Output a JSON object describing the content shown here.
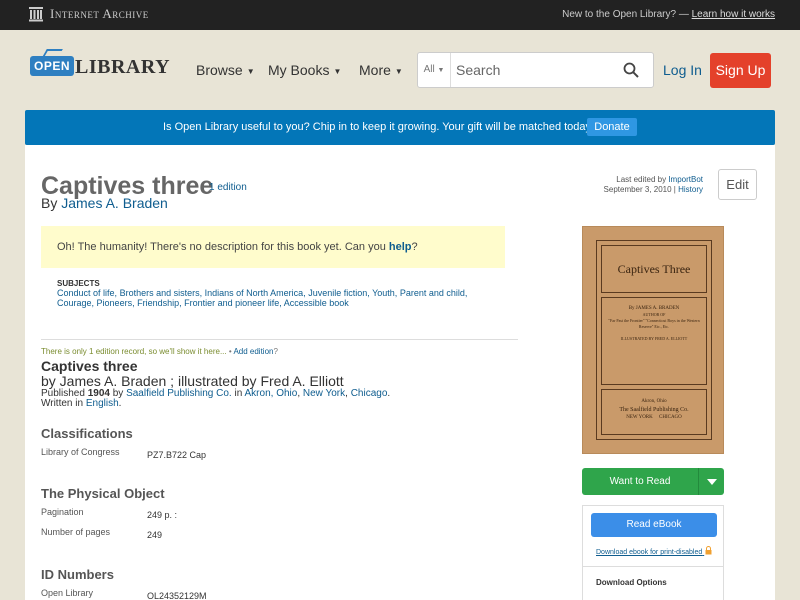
{
  "ia_bar": {
    "logo_text": "Internet Archive",
    "new_text": "New to the Open Library? —",
    "learn_link": "Learn how it works"
  },
  "header": {
    "logo_open": "OPEN",
    "logo_library": "LIBRARY",
    "nav": [
      {
        "label": "Browse"
      },
      {
        "label": "My Books"
      },
      {
        "label": "More"
      }
    ],
    "search_scope": "All",
    "search_placeholder": "Search",
    "login_label": "Log In",
    "signup_label": "Sign Up"
  },
  "donate": {
    "text": "Is Open Library useful to you? Chip in to keep it growing. Your gift will be matched today!",
    "button": "Donate"
  },
  "book": {
    "title": "Captives three",
    "editions_link": "1 edition",
    "by_prefix": "By",
    "author": "James A. Braden",
    "last_edited_prefix": "Last edited by",
    "last_edited_user": "ImportBot",
    "last_edited_date": "September 3, 2010",
    "history_link": "History",
    "edit_label": "Edit",
    "nodesc_text": "Oh! The humanity! There's no description for this book yet. Can you",
    "nodesc_link": "help",
    "nodesc_end": "?",
    "subjects_label": "SUBJECTS",
    "subjects": [
      "Conduct of life",
      "Brothers and sisters",
      "Indians of North America",
      "Juvenile fiction",
      "Youth",
      "Parent and child",
      "Courage",
      "Pioneers",
      "Friendship",
      "Frontier and pioneer life",
      "Accessible book"
    ]
  },
  "edition": {
    "only_text": "There is only 1 edition record, so we'll show it here...",
    "bullet": "•",
    "add_link": "Add edition",
    "add_q": "?",
    "title": "Captives three",
    "by": "by James A. Braden ; illustrated by Fred A. Elliott",
    "published_prefix": "Published",
    "year": "1904",
    "by_word": "by",
    "publisher": "Saalfield Publishing Co.",
    "in_word": "in",
    "places": [
      "Akron, Ohio",
      "New York",
      "Chicago"
    ],
    "written_prefix": "Written in",
    "language": "English"
  },
  "classifications": {
    "heading": "Classifications",
    "rows": [
      {
        "key": "Library of Congress",
        "value": "PZ7.B722 Cap"
      }
    ]
  },
  "physical": {
    "heading": "The Physical Object",
    "rows": [
      {
        "key": "Pagination",
        "value": "249 p. :"
      },
      {
        "key": "Number of pages",
        "value": "249"
      }
    ]
  },
  "ids": {
    "heading": "ID Numbers",
    "rows": [
      {
        "key": "Open Library",
        "value": "OL24352129M"
      }
    ]
  },
  "cover": {
    "title": "Captives Three",
    "by_line": "By JAMES A. BRADEN",
    "author_of": "AUTHOR OF",
    "works": "\"Far Past the Frontier\" \"Connecticut Boys in the Western Reserve\" Etc., Etc.",
    "illus": "ILLUSTRATED BY FRED A. ELLIOTT",
    "city": "Akron, Ohio",
    "publisher": "The Saalfield Publishing Co.",
    "cities": "NEW YORK     CHICAGO"
  },
  "sidebar": {
    "want_read": "Want to Read",
    "read_ebook": "Read eBook",
    "download_print": "Download ebook for print-disabled",
    "download_options": "Download Options"
  },
  "colors": {
    "accent_blue": "#0376b8",
    "signup_red": "#e4412b",
    "want_green": "#2fa54b",
    "ebook_blue": "#3b8ee8"
  }
}
